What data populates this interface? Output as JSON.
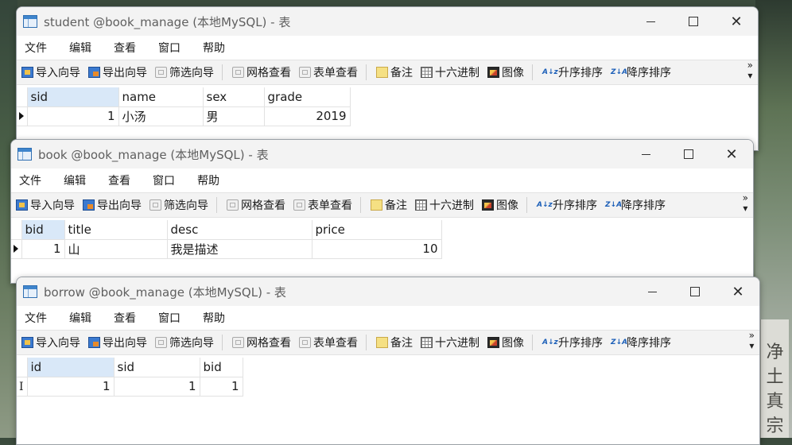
{
  "background": {
    "sign_chars": [
      "净",
      "土",
      "真",
      "宗"
    ]
  },
  "menus": [
    "文件",
    "编辑",
    "查看",
    "窗口",
    "帮助"
  ],
  "toolbar": {
    "import": "导入向导",
    "export": "导出向导",
    "filter": "筛选向导",
    "grid_view": "网格查看",
    "form_view": "表单查看",
    "note": "备注",
    "hex": "十六进制",
    "image": "图像",
    "sort_asc": "升序排序",
    "sort_desc": "降序排序",
    "more": "»"
  },
  "icons": {
    "window": "table-icon",
    "import": "import-wizard-icon",
    "export": "export-wizard-icon",
    "filter": "filter-wizard-icon",
    "grid": "grid-view-icon",
    "form": "form-view-icon",
    "note": "note-icon",
    "hex": "hex-icon",
    "image": "image-icon",
    "sort_asc": "sort-ascending-icon",
    "sort_desc": "sort-descending-icon"
  },
  "windows": [
    {
      "title": "student @book_manage (本地MySQL) - 表",
      "columns": [
        "sid",
        "name",
        "sex",
        "grade"
      ],
      "rows": [
        [
          "1",
          "小汤",
          "男",
          "2019"
        ]
      ]
    },
    {
      "title": "book @book_manage (本地MySQL) - 表",
      "columns": [
        "bid",
        "title",
        "desc",
        "price"
      ],
      "rows": [
        [
          "1",
          "山",
          "我是描述",
          "10"
        ]
      ]
    },
    {
      "title": "borrow @book_manage (本地MySQL) - 表",
      "columns": [
        "id",
        "sid",
        "bid"
      ],
      "rows": [
        [
          "1",
          "1",
          "1"
        ]
      ]
    }
  ]
}
